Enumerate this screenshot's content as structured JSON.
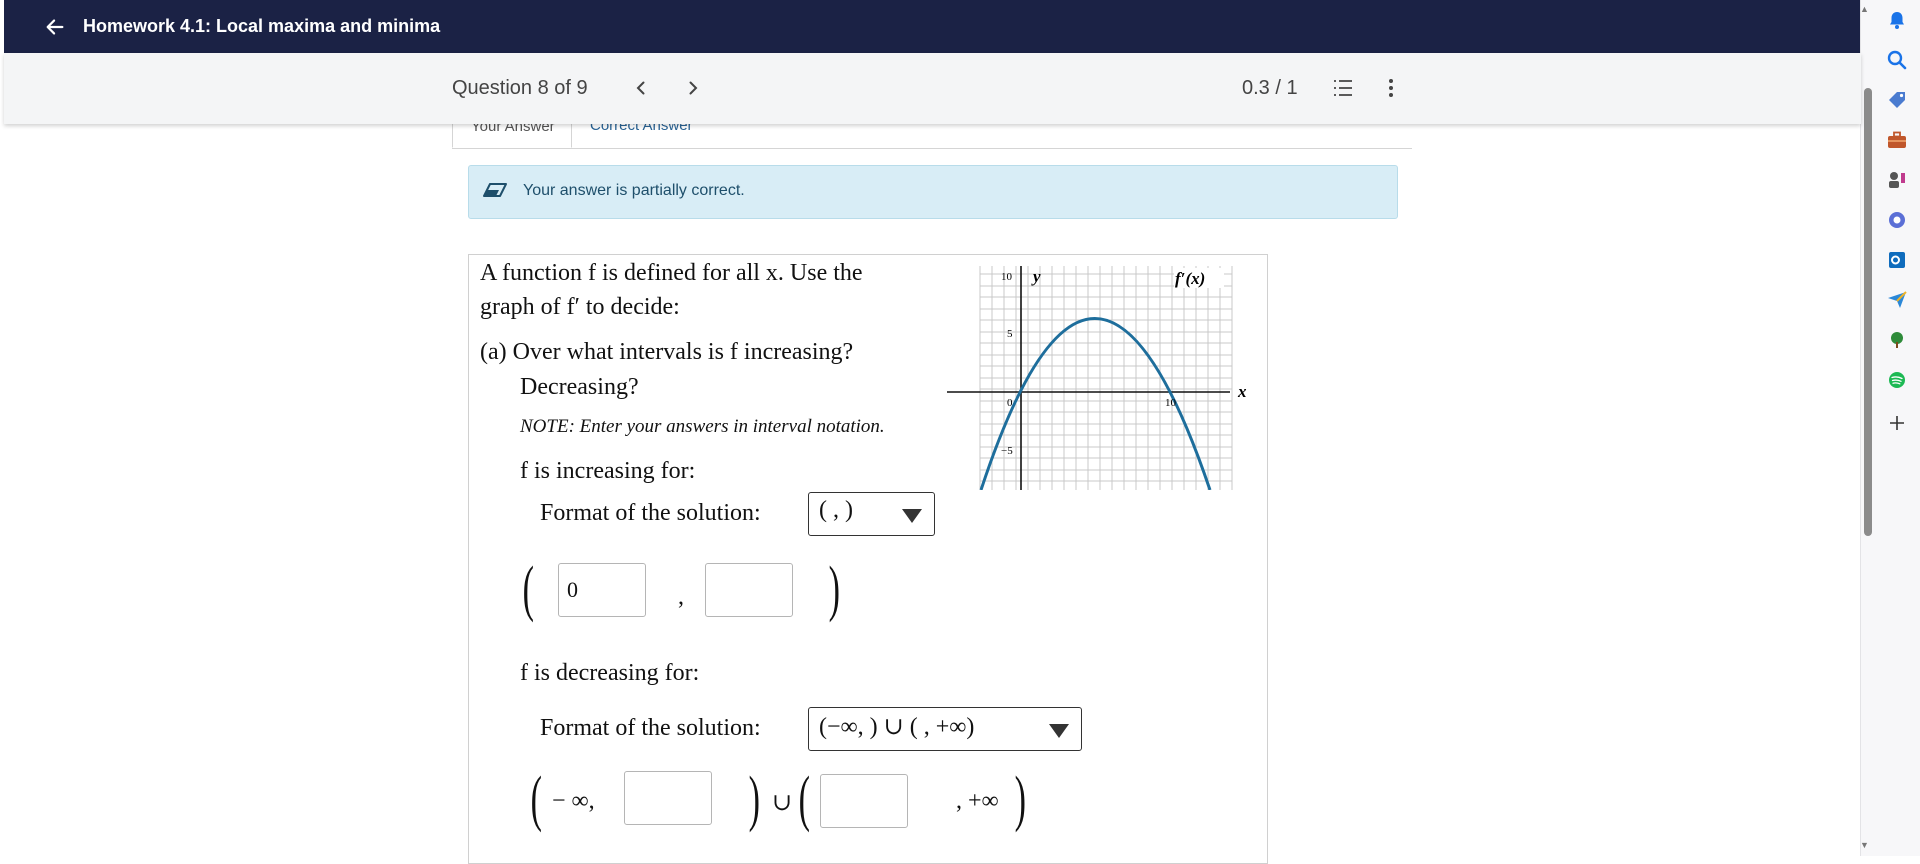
{
  "topbar": {
    "title": "Homework 4.1: Local maxima and minima"
  },
  "header": {
    "question_label": "Question 8 of 9",
    "score": "0.3 / 1"
  },
  "tabs": {
    "your_answer": "Your Answer",
    "correct_answer": "Correct Answer"
  },
  "alert": {
    "text": "Your answer is partially correct."
  },
  "problem": {
    "line1": "A function f is defined for all x. Use the",
    "line2": "graph of f′ to decide:",
    "part_a_line1": "(a) Over what intervals is f increasing?",
    "part_a_line2": "Decreasing?",
    "note": "NOTE: Enter your answers in interval notation.",
    "increasing_label": "f is increasing for:",
    "decreasing_label": "f is decreasing for:",
    "format_label": "Format of the solution:",
    "increasing_format": "(    ,     )",
    "decreasing_format": "(−∞,      ) ∪ (     , +∞)",
    "increasing_input_1": "0",
    "increasing_input_2": "",
    "decreasing_input_1": "",
    "decreasing_input_2": "",
    "neg_inf": "− ∞,",
    "pos_inf": ", +∞",
    "union": "∪",
    "comma": ","
  },
  "graph": {
    "y_label": "y",
    "x_label": "x",
    "curve_label": "f′(x)",
    "ticks": {
      "y10": "10",
      "y5": "5",
      "y0": "0",
      "yneg5": "−5",
      "x10": "10"
    }
  },
  "colors": {
    "topbar": "#1b2245",
    "curve": "#1e6e9c",
    "alert_bg": "#d8edf6"
  }
}
